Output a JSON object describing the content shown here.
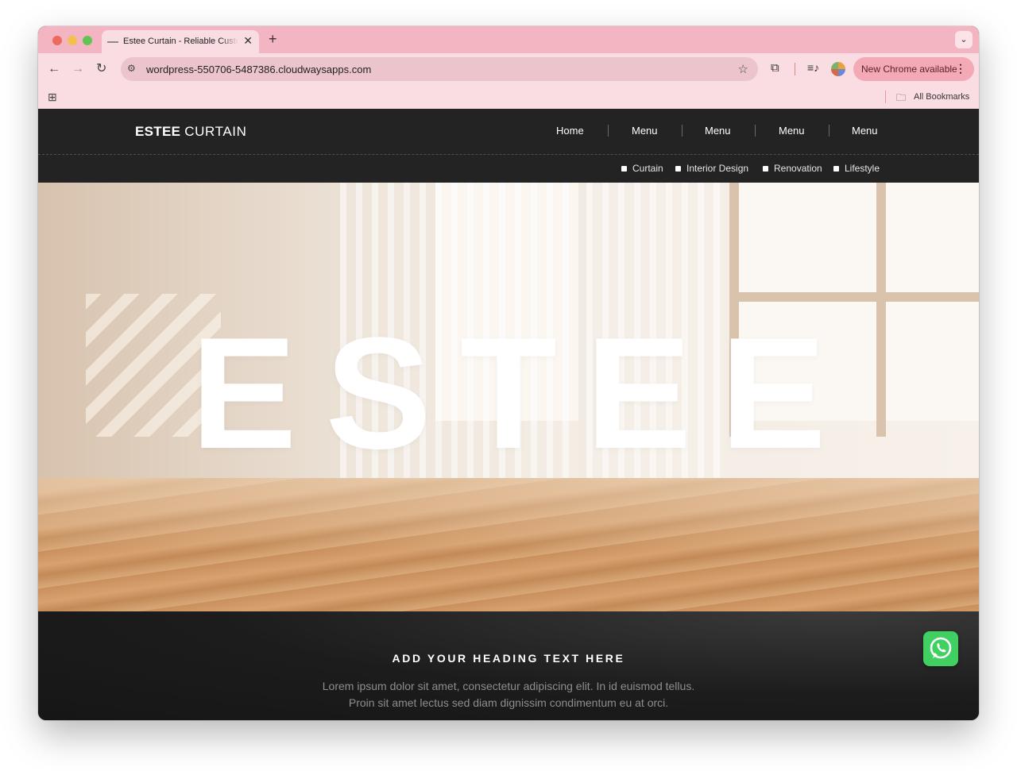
{
  "browser": {
    "tab_title": "Estee Curtain - Reliable Custo",
    "tab_close": "✕",
    "new_tab": "+",
    "tab_menu": "⌄",
    "url": "wordpress-550706-5487386.cloudwaysapps.com",
    "back": "←",
    "forward": "→",
    "reload": "↻",
    "site_info": "⚙",
    "star": "☆",
    "extensions": "⧉",
    "media": "≡♪",
    "update_label": "New Chrome available",
    "update_menu": "⋮",
    "apps": "⊞",
    "folder": "🗀",
    "bookmarks_label": "All Bookmarks"
  },
  "site": {
    "logo_bold": "ESTEE",
    "logo_light": "CURTAIN",
    "nav": [
      "Home",
      "Menu",
      "Menu",
      "Menu",
      "Menu"
    ],
    "subnav": [
      "Curtain",
      "Interior Design",
      "Renovation",
      "Lifestyle"
    ],
    "hero_title": "ESTEE",
    "section_heading": "ADD YOUR HEADING TEXT HERE",
    "section_text_1": "Lorem ipsum dolor sit amet, consectetur adipiscing elit. In id euismod tellus.",
    "section_text_2": "Proin sit amet lectus sed diam dignissim condimentum eu at orci."
  },
  "icons": {
    "whatsapp": "whatsapp-icon"
  },
  "colors": {
    "tabstrip": "#f3b5c1",
    "toolbar": "#fadde3",
    "header": "#232323",
    "whatsapp": "#3fd061"
  }
}
